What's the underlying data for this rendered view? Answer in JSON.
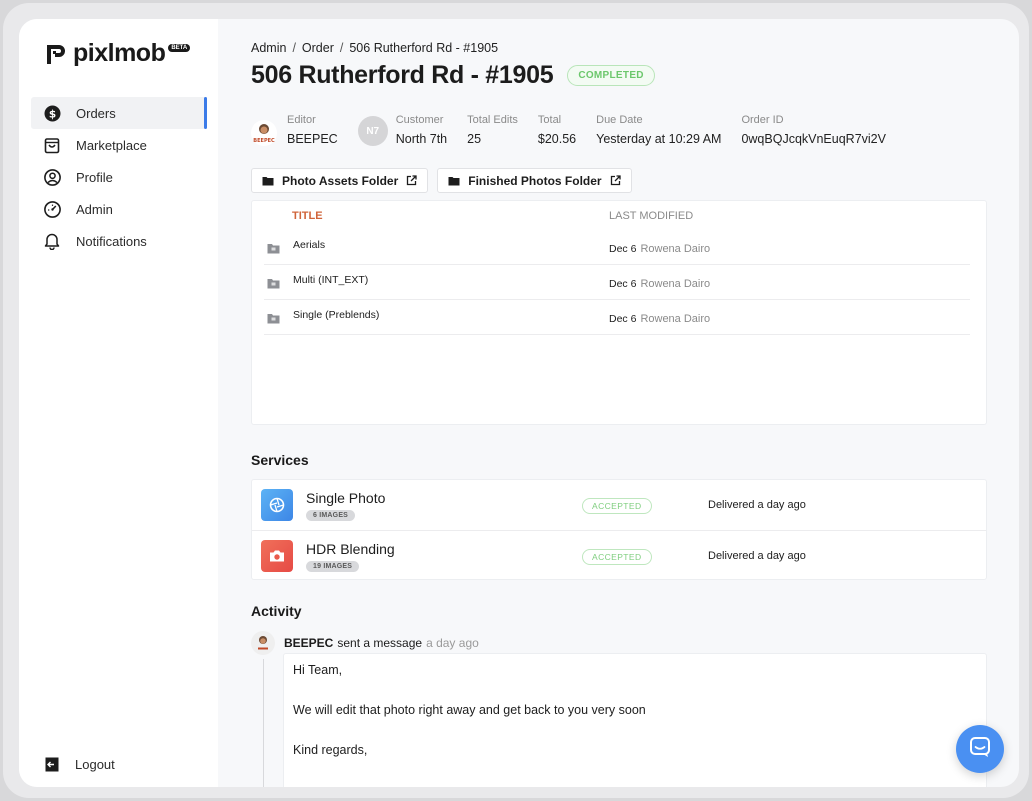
{
  "app": {
    "name": "pixlmob",
    "badge": "BETA"
  },
  "sidebar": {
    "items": [
      {
        "label": "Orders",
        "icon": "dollar-circle-icon",
        "active": true
      },
      {
        "label": "Marketplace",
        "icon": "shopping-bag-icon",
        "active": false
      },
      {
        "label": "Profile",
        "icon": "user-circle-icon",
        "active": false
      },
      {
        "label": "Admin",
        "icon": "gauge-icon",
        "active": false
      },
      {
        "label": "Notifications",
        "icon": "bell-icon",
        "active": false
      }
    ],
    "logout_label": "Logout"
  },
  "breadcrumb": {
    "items": [
      "Admin",
      "Order",
      "506 Rutherford Rd - #1905"
    ],
    "separator": "/"
  },
  "order": {
    "title": "506 Rutherford Rd - #1905",
    "status": "COMPLETED",
    "editor_label": "Editor",
    "editor": "BEEPEC",
    "editor_avatar_text": "BEEPEC",
    "customer_label": "Customer",
    "customer_initials": "N7",
    "customer": "North 7th",
    "edits_label": "Total Edits",
    "edits": "25",
    "total_label": "Total",
    "total": "$20.56",
    "due_label": "Due Date",
    "due": "Yesterday at 10:29 AM",
    "id_label": "Order ID",
    "id": "0wqBQJcqkVnEuqR7vi2V"
  },
  "folders": {
    "assets_label": "Photo Assets Folder",
    "finished_label": "Finished Photos Folder"
  },
  "files": {
    "columns": [
      "TITLE",
      "LAST MODIFIED"
    ],
    "rows": [
      {
        "name": "Aerials",
        "date": "Dec 6",
        "editor": "Rowena Dairo"
      },
      {
        "name": "Multi (INT_EXT)",
        "date": "Dec 6",
        "editor": "Rowena Dairo"
      },
      {
        "name": "Single (Preblends)",
        "date": "Dec 6",
        "editor": "Rowena Dairo"
      }
    ]
  },
  "services": {
    "heading": "Services",
    "items": [
      {
        "name": "Single Photo",
        "count": "6 IMAGES",
        "status": "ACCEPTED",
        "delivered": "Delivered a day ago",
        "color": "#4a9ff0"
      },
      {
        "name": "HDR Blending",
        "count": "19 IMAGES",
        "status": "ACCEPTED",
        "delivered": "Delivered a day ago",
        "color": "#ec5a4c"
      }
    ]
  },
  "activity": {
    "heading": "Activity",
    "user": "BEEPEC",
    "action": "sent a message",
    "time": "a day ago",
    "message_lines": [
      "Hi Team,",
      "We will edit that photo right away and get back to you very soon",
      "Kind regards,"
    ]
  },
  "colors": {
    "accent": "#3b7be8",
    "status_green": "#6cc76c",
    "title_orange": "#d0643a",
    "chat_blue": "#4a90f2"
  }
}
